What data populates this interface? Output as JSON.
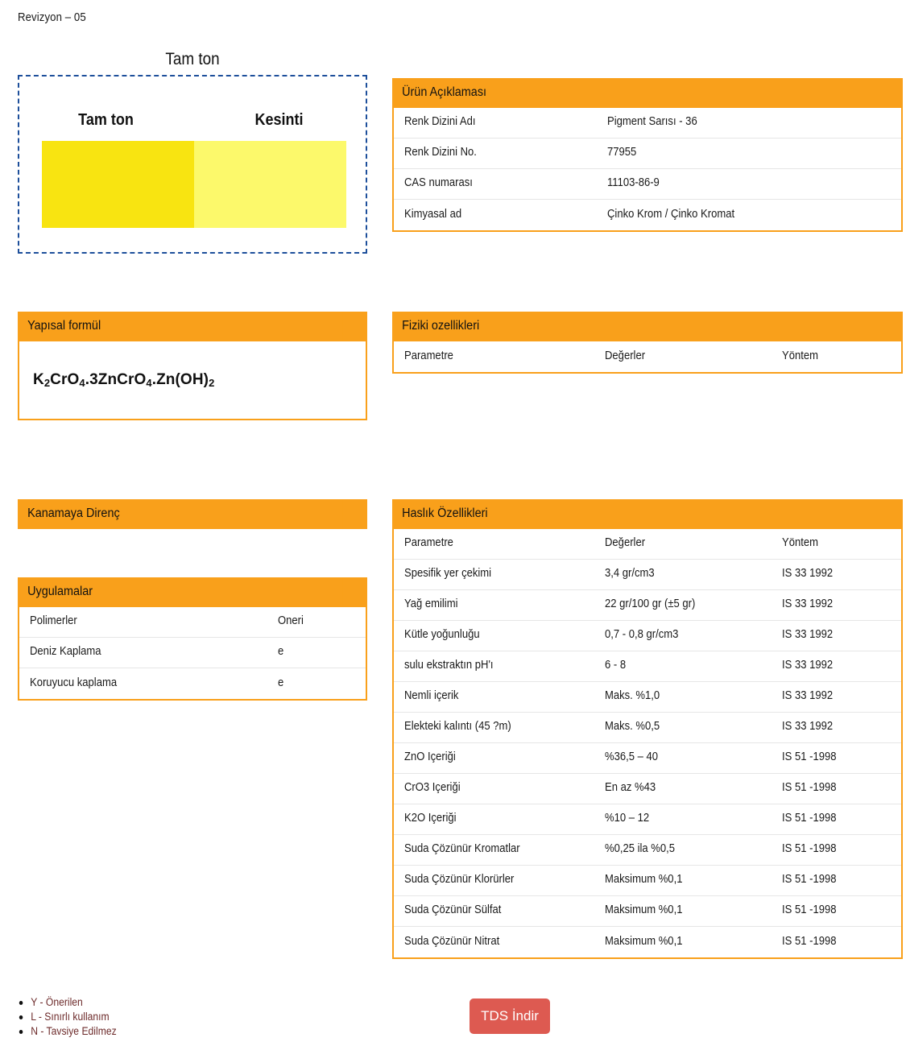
{
  "revision": "Revizyon – 05",
  "swatch_panel": {
    "title": "Tam ton",
    "left_label": "Tam ton",
    "right_label": "Kesinti",
    "left_color": "#f8e411",
    "right_color": "#fcf96b",
    "border_color": "#1d4f9b"
  },
  "theme": {
    "accent_orange": "#f9a01b",
    "button_red": "#dd5a51",
    "legend_text": "#6d2b2b"
  },
  "product_description": {
    "heading": "Ürün Açıklaması",
    "rows": [
      {
        "label": "Renk Dizini Adı",
        "value": "Pigment Sarısı - 36"
      },
      {
        "label": "Renk Dizini No.",
        "value": "77955"
      },
      {
        "label": "CAS numarası",
        "value": "11103-86-9"
      },
      {
        "label": "Kimyasal ad",
        "value": "Çinko Krom / Çinko Kromat"
      }
    ]
  },
  "structural_formula": {
    "heading": "Yapısal formül",
    "formula_parts": [
      {
        "text": "K",
        "sub": "2"
      },
      {
        "text": "CrO",
        "sub": "4"
      },
      {
        "text": ".3ZnCrO",
        "sub": "4"
      },
      {
        "text": ".Zn(OH)",
        "sub": "2"
      }
    ],
    "formula_plain": "K2CrO4.3ZnCrO4.Zn(OH)2"
  },
  "physical_properties": {
    "heading": "Fiziki ozellikleri",
    "columns": [
      "Parametre",
      "Değerler",
      "Yöntem"
    ],
    "rows": []
  },
  "bleed_resistance": {
    "heading": "Kanamaya Direnç"
  },
  "applications": {
    "heading": "Uygulamalar",
    "columns": [
      "Polimerler",
      "Öneri"
    ],
    "rows": [
      {
        "polymer": "Deniz Kaplama",
        "recommendation": "e"
      },
      {
        "polymer": "Koruyucu kaplama",
        "recommendation": "e"
      }
    ]
  },
  "fastness_properties": {
    "heading": "Haslık Özellikleri",
    "columns": [
      "Parametre",
      "Değerler",
      "Yöntem"
    ],
    "rows": [
      {
        "parameter": "Spesifik yer çekimi",
        "value": "3,4 gr/cm3",
        "method": "IS 33 1992"
      },
      {
        "parameter": "Yağ emilimi",
        "value": "22 gr/100 gr (±5 gr)",
        "method": "IS 33 1992"
      },
      {
        "parameter": "Kütle yoğunluğu",
        "value": "0,7 - 0,8 gr/cm3",
        "method": "IS 33 1992"
      },
      {
        "parameter": "sulu ekstraktın pH'ı",
        "value": "6 - 8",
        "method": "IS 33 1992"
      },
      {
        "parameter": "Nemli içerik",
        "value": "Maks. %1,0",
        "method": "IS 33 1992"
      },
      {
        "parameter": "Elekteki kalıntı (45 ?m)",
        "value": "Maks. %0,5",
        "method": "IS 33 1992"
      },
      {
        "parameter": "ZnO İçeriği",
        "value": "%36,5 – 40",
        "method": "IS 51 -1998"
      },
      {
        "parameter": "CrO3 İçeriği",
        "value": "En az %43",
        "method": "IS 51 -1998"
      },
      {
        "parameter": "K2O İçeriği",
        "value": "%10 – 12",
        "method": "IS 51 -1998"
      },
      {
        "parameter": "Suda Çözünür Kromatlar",
        "value": "%0,25 ila %0,5",
        "method": "IS 51 -1998"
      },
      {
        "parameter": "Suda Çözünür Klorürler",
        "value": "Maksimum %0,1",
        "method": "IS 51 -1998"
      },
      {
        "parameter": "Suda Çözünür Sülfat",
        "value": "Maksimum %0,1",
        "method": "IS 51 -1998"
      },
      {
        "parameter": "Suda Çözünür Nitrat",
        "value": "Maksimum %0,1",
        "method": "IS 51 -1998"
      }
    ]
  },
  "legend": [
    "Y - Önerilen",
    "L - Sınırlı kullanım",
    "N - Tavsiye Edilmez"
  ],
  "download_button": {
    "label": "TDS İndir"
  }
}
